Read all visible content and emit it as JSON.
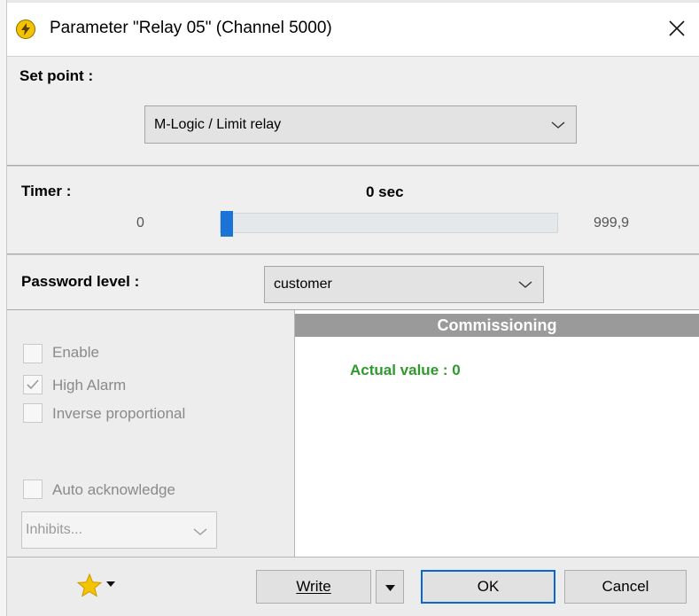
{
  "window": {
    "title": "Parameter \"Relay 05\" (Channel 5000)"
  },
  "setpoint": {
    "label": "Set point :",
    "selected": "M-Logic / Limit relay"
  },
  "timer": {
    "label": "Timer :",
    "current": "0 sec",
    "min": "0",
    "max": "999,9",
    "value": 0,
    "max_value": 999.9
  },
  "password": {
    "label": "Password level :",
    "selected": "customer"
  },
  "options": {
    "enable": {
      "label": "Enable",
      "checked": false
    },
    "high_alarm": {
      "label": "High Alarm",
      "checked": true
    },
    "inverse": {
      "label": "Inverse proportional",
      "checked": false
    },
    "auto_ack": {
      "label": "Auto acknowledge",
      "checked": false
    },
    "inhibits": {
      "placeholder": "Inhibits..."
    }
  },
  "commissioning": {
    "title": "Commissioning",
    "actual_value": "Actual value : 0"
  },
  "buttons": {
    "write": "Write",
    "ok": "OK",
    "cancel": "Cancel"
  },
  "colors": {
    "accent": "#1a73d6",
    "ok_border": "#0a66d0",
    "actual_value": "#2e9a2e"
  },
  "icons": {
    "app": "lightning-icon",
    "close": "close-icon",
    "favorite": "star-icon"
  }
}
